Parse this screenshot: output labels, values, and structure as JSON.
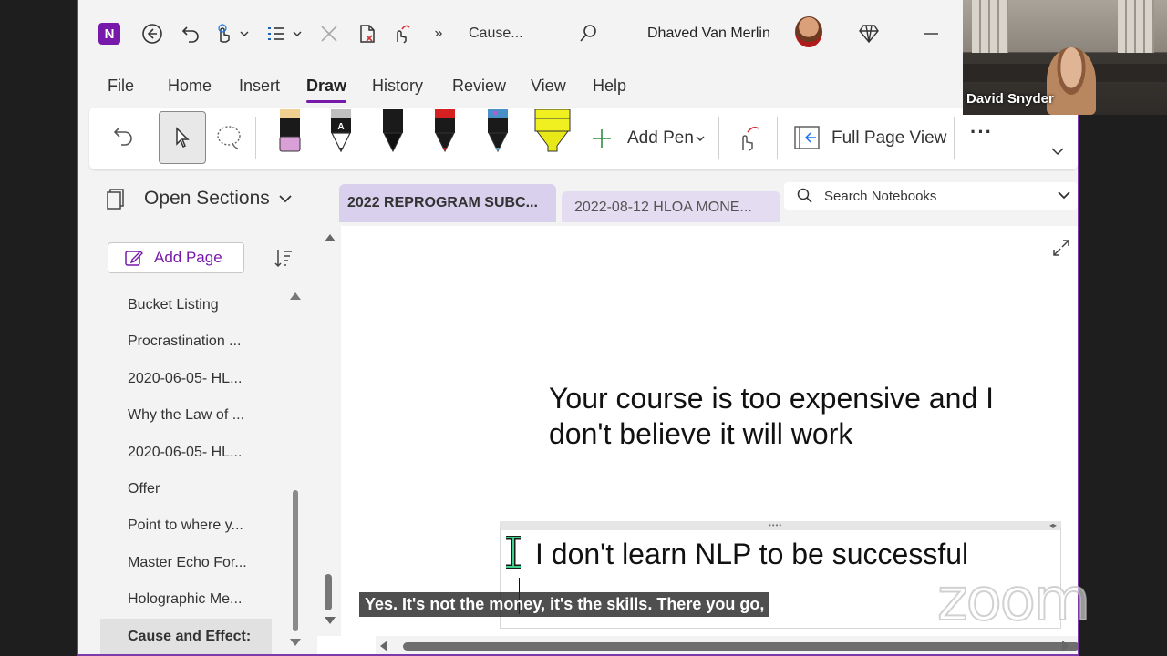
{
  "titlebar": {
    "app_logo": "N",
    "page_title": "Cause...",
    "user_name": "Dhaved Van Merlin",
    "icons": [
      "back-icon",
      "undo-icon",
      "touch-icon",
      "list-icon",
      "close-icon",
      "document-icon",
      "ink-icon",
      "more-chevron-icon",
      "search-icon",
      "premium-icon",
      "minimize-icon"
    ]
  },
  "menu": {
    "items": [
      "File",
      "Home",
      "Insert",
      "Draw",
      "History",
      "Review",
      "View",
      "Help"
    ],
    "active": "Draw"
  },
  "ribbon": {
    "add_pen_label": "Add Pen",
    "full_page_label": "Full Page View",
    "more_label": "···",
    "pens": [
      {
        "body": "#1a1a1a",
        "cap": "#f0d090",
        "tip": "#d9a0d8",
        "kind": "highlighter"
      },
      {
        "body": "#1a1a1a",
        "cap": "#c0c0c0",
        "tip": "#333333",
        "kind": "pencil",
        "mark": "A"
      },
      {
        "body": "#1a1a1a",
        "cap": "#1a1a1a",
        "tip": "#111111",
        "kind": "pen"
      },
      {
        "body": "#1a1a1a",
        "cap": "#d42020",
        "tip": "#c01818",
        "kind": "pen"
      },
      {
        "body": "#1a1a1a",
        "cap": "#4a90c8",
        "tip": "#5ab0d8",
        "kind": "galaxy"
      },
      {
        "body": "#f0f020",
        "cap": "#f0f020",
        "tip": "#e8e818",
        "kind": "highlighter-wide"
      }
    ]
  },
  "sections": {
    "open_label": "Open Sections",
    "tabs": [
      "2022 REPROGRAM SUBC...",
      "2022-08-12 HLOA  MONE..."
    ],
    "search_placeholder": "Search Notebooks"
  },
  "pages": {
    "add_label": "Add Page",
    "items": [
      "Bucket Listing",
      "Procrastination ...",
      "2020-06-05- HL...",
      "Why the Law of ...",
      "2020-06-05- HL...",
      "Offer",
      "Point to where y...",
      "Master Echo For...",
      "Holographic Me...",
      "Cause and Effect:"
    ],
    "selected_index": 9
  },
  "canvas": {
    "note1": "Your course is too expensive and I don't believe it will work",
    "note2": "I don't learn NLP to be successful"
  },
  "meeting": {
    "caption": "Yes. It's not the money, it's the skills. There you go,",
    "watermark": "zoom",
    "participant_name": "David Snyder"
  }
}
